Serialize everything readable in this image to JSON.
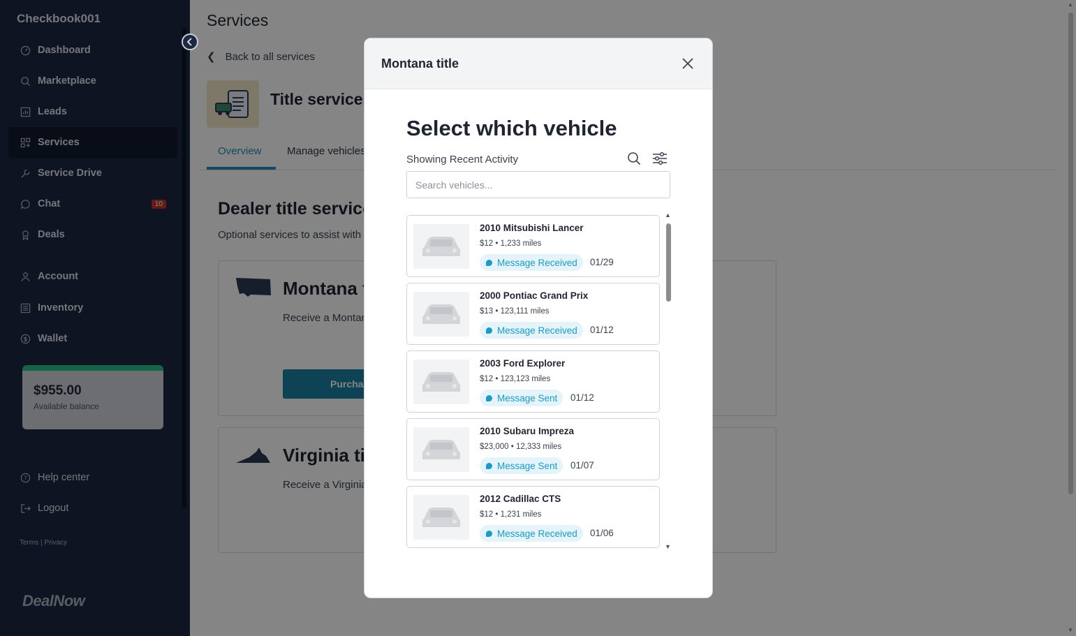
{
  "sidebar": {
    "brand": "Checkbook001",
    "items": [
      {
        "label": "Dashboard",
        "icon": "dashboard-icon"
      },
      {
        "label": "Marketplace",
        "icon": "search-icon"
      },
      {
        "label": "Leads",
        "icon": "chart-icon"
      },
      {
        "label": "Services",
        "icon": "grid-icon"
      },
      {
        "label": "Service Drive",
        "icon": "wrench-icon"
      },
      {
        "label": "Chat",
        "icon": "chat-icon",
        "badge": "10"
      },
      {
        "label": "Deals",
        "icon": "ribbon-icon"
      },
      {
        "label": "Account",
        "icon": "user-icon"
      },
      {
        "label": "Inventory",
        "icon": "inventory-icon"
      },
      {
        "label": "Wallet",
        "icon": "dollar-icon"
      }
    ],
    "balance": {
      "amount": "$955.00",
      "label": "Available balance"
    },
    "help": "Help center",
    "logout": "Logout",
    "terms": "Terms  |  Privacy",
    "logo": "DealNow"
  },
  "main": {
    "page_title": "Services",
    "back_label": "Back to all services",
    "service_title": "Title services",
    "tabs": [
      "Overview",
      "Manage vehicles"
    ],
    "section_title": "Dealer title services",
    "section_sub": "Optional services to assist with",
    "cards": [
      {
        "title": "Montana title",
        "desc": "Receive a Montana title. Estimated turn around time with lien release.",
        "button": "Purchase"
      },
      {
        "title": "Virginia title",
        "desc": "Receive a Virginia title. Estimated turn around time with lien release."
      }
    ]
  },
  "modal": {
    "title": "Montana title",
    "heading": "Select which vehicle",
    "showing": "Showing Recent Activity",
    "search_placeholder": "Search vehicles...",
    "vehicles": [
      {
        "name": "2010 Mitsubishi Lancer",
        "meta": "$12 • 1,233 miles",
        "status": "Message Received",
        "date": "01/29"
      },
      {
        "name": "2000 Pontiac Grand Prix",
        "meta": "$13 • 123,111 miles",
        "status": "Message Received",
        "date": "01/12"
      },
      {
        "name": "2003 Ford Explorer",
        "meta": "$12 • 123,123 miles",
        "status": "Message Sent",
        "date": "01/12"
      },
      {
        "name": "2010 Subaru Impreza",
        "meta": "$23,000 • 12,333 miles",
        "status": "Message Sent",
        "date": "01/07"
      },
      {
        "name": "2012 Cadillac CTS",
        "meta": "$12 • 1,231 miles",
        "status": "Message Received",
        "date": "01/06"
      }
    ]
  },
  "colors": {
    "sidebar": "#1c2740",
    "accent": "#1d8fb8",
    "pill_text": "#1a9bc6",
    "pill_bg": "#e4f4fa",
    "balance_stripe": "#27c28a"
  }
}
